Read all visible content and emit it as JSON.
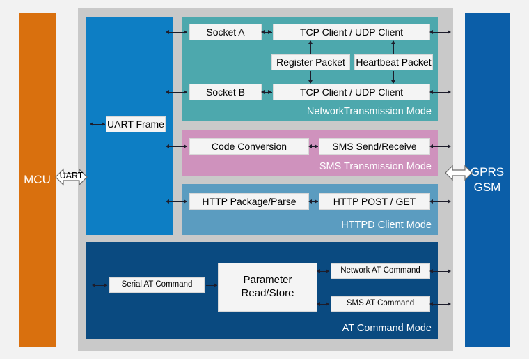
{
  "diagram": {
    "title": "GPRS/GSM module functional block diagram",
    "background_color": "#f2f2f2",
    "container_color": "#c9c9c9"
  },
  "left_bar": {
    "label": "MCU",
    "color": "#d9700e"
  },
  "right_bar": {
    "line1": "GPRS",
    "line2": "GSM",
    "color": "#0b5ea8"
  },
  "connectors": {
    "uart_label": "UART",
    "uart_icon": "double-arrow-horizontal-icon",
    "gprs_icon": "double-arrow-horizontal-icon"
  },
  "uart_column": {
    "color": "#0d7ec4",
    "frame_block": "UART Frame"
  },
  "network_mode": {
    "caption": "NetworkTransmission Mode",
    "color": "#4da8ad",
    "blocks": {
      "socket_a": "Socket A",
      "socket_b": "Socket B",
      "client_top": "TCP Client / UDP Client",
      "client_bottom": "TCP Client / UDP Client",
      "register_packet": "Register Packet",
      "heartbeat_packet": "Heartbeat Packet"
    }
  },
  "sms_mode": {
    "caption": "SMS Transmission Mode",
    "color": "#cf92bd",
    "blocks": {
      "code_conversion": "Code Conversion",
      "sms_send_receive": "SMS Send/Receive"
    }
  },
  "httpd_mode": {
    "caption": "HTTPD Client Mode",
    "color": "#5b9cc0",
    "blocks": {
      "http_package_parse": "HTTP Package/Parse",
      "http_post_get": "HTTP POST / GET"
    }
  },
  "at_mode": {
    "caption": "AT Command Mode",
    "color": "#0a4a80",
    "blocks": {
      "serial_at": "Serial AT Command",
      "parameter_store": "Parameter\nRead/Store",
      "parameter_store_line1": "Parameter",
      "parameter_store_line2": "Read/Store",
      "network_at": "Network AT Command",
      "sms_at": "SMS AT Command"
    }
  }
}
